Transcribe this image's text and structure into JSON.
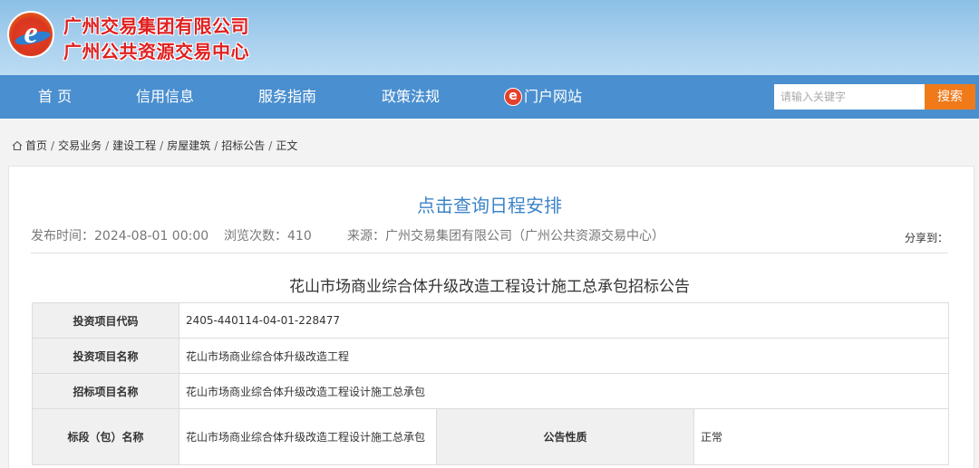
{
  "header": {
    "org_line1": "广州交易集团有限公司",
    "org_line2": "广州公共资源交易中心",
    "logo_letter": "e"
  },
  "nav": {
    "home": "首 页",
    "credit": "信用信息",
    "guide": "服务指南",
    "policy": "政策法规",
    "portal": "门户网站",
    "portal_icon_letter": "e"
  },
  "search": {
    "placeholder": "请输入关键字",
    "button": "搜索"
  },
  "breadcrumb": {
    "items": [
      "首页",
      "交易业务",
      "建设工程",
      "房屋建筑",
      "招标公告",
      "正文"
    ],
    "separator": "/"
  },
  "article": {
    "schedule_link": "点击查询日程安排",
    "publish_time": "发布时间：2024-08-01 00:00",
    "views": "浏览次数：410",
    "source": "来源：广州交易集团有限公司（广州公共资源交易中心）",
    "share_label": "分享到：",
    "title": "花山市场商业综合体升级改造工程设计施工总承包招标公告"
  },
  "table": {
    "rows": [
      {
        "label": "投资项目代码",
        "value": "2405-440114-04-01-228477"
      },
      {
        "label": "投资项目名称",
        "value": "花山市场商业综合体升级改造工程"
      },
      {
        "label": "招标项目名称",
        "value": "花山市场商业综合体升级改造工程设计施工总承包"
      }
    ],
    "section_row": {
      "label": "标段（包）名称",
      "value": "花山市场商业综合体升级改造工程设计施工总承包",
      "mid_label": "公告性质",
      "mid_value": "正常"
    }
  },
  "colors": {
    "nav_bg": "#4a8fcf",
    "header_top": "#8cc0e6",
    "search_button": "#f07a1a",
    "org_name": "#e02020",
    "link": "#3c84c8"
  }
}
